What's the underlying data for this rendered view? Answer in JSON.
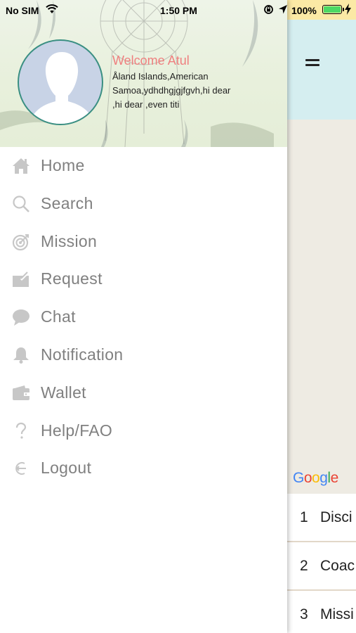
{
  "status_bar": {
    "carrier": "No SIM",
    "time": "1:50 PM",
    "battery": "100%",
    "battery_color": "#4cd964",
    "icons": [
      "wifi-icon",
      "rotation-lock-icon",
      "location-arrow-icon",
      "battery-icon",
      "charging-bolt-icon"
    ]
  },
  "drawer": {
    "welcome": "Welcome Atul",
    "location": "Åland Islands,American Samoa,ydhdhgjgjfgvh,hi dear ,hi dear ,even titi",
    "welcome_color": "#ef7f7f",
    "menu": [
      {
        "label": "Home",
        "icon": "home-icon"
      },
      {
        "label": "Search",
        "icon": "search-icon"
      },
      {
        "label": "Mission",
        "icon": "target-icon"
      },
      {
        "label": "Request",
        "icon": "request-icon"
      },
      {
        "label": "Chat",
        "icon": "chat-bubble-icon"
      },
      {
        "label": "Notification",
        "icon": "bell-icon"
      },
      {
        "label": "Wallet",
        "icon": "wallet-icon"
      },
      {
        "label": "Help/FAO",
        "icon": "question-icon"
      },
      {
        "label": "Logout",
        "icon": "logout-icon"
      }
    ]
  },
  "main": {
    "menu_icon": "hamburger-icon",
    "header_color": "#d5eef0",
    "map_logo": "Google",
    "list": [
      {
        "num": "1",
        "text": "Disci"
      },
      {
        "num": "2",
        "text": "Coac"
      },
      {
        "num": "3",
        "text": "Missi"
      }
    ]
  }
}
